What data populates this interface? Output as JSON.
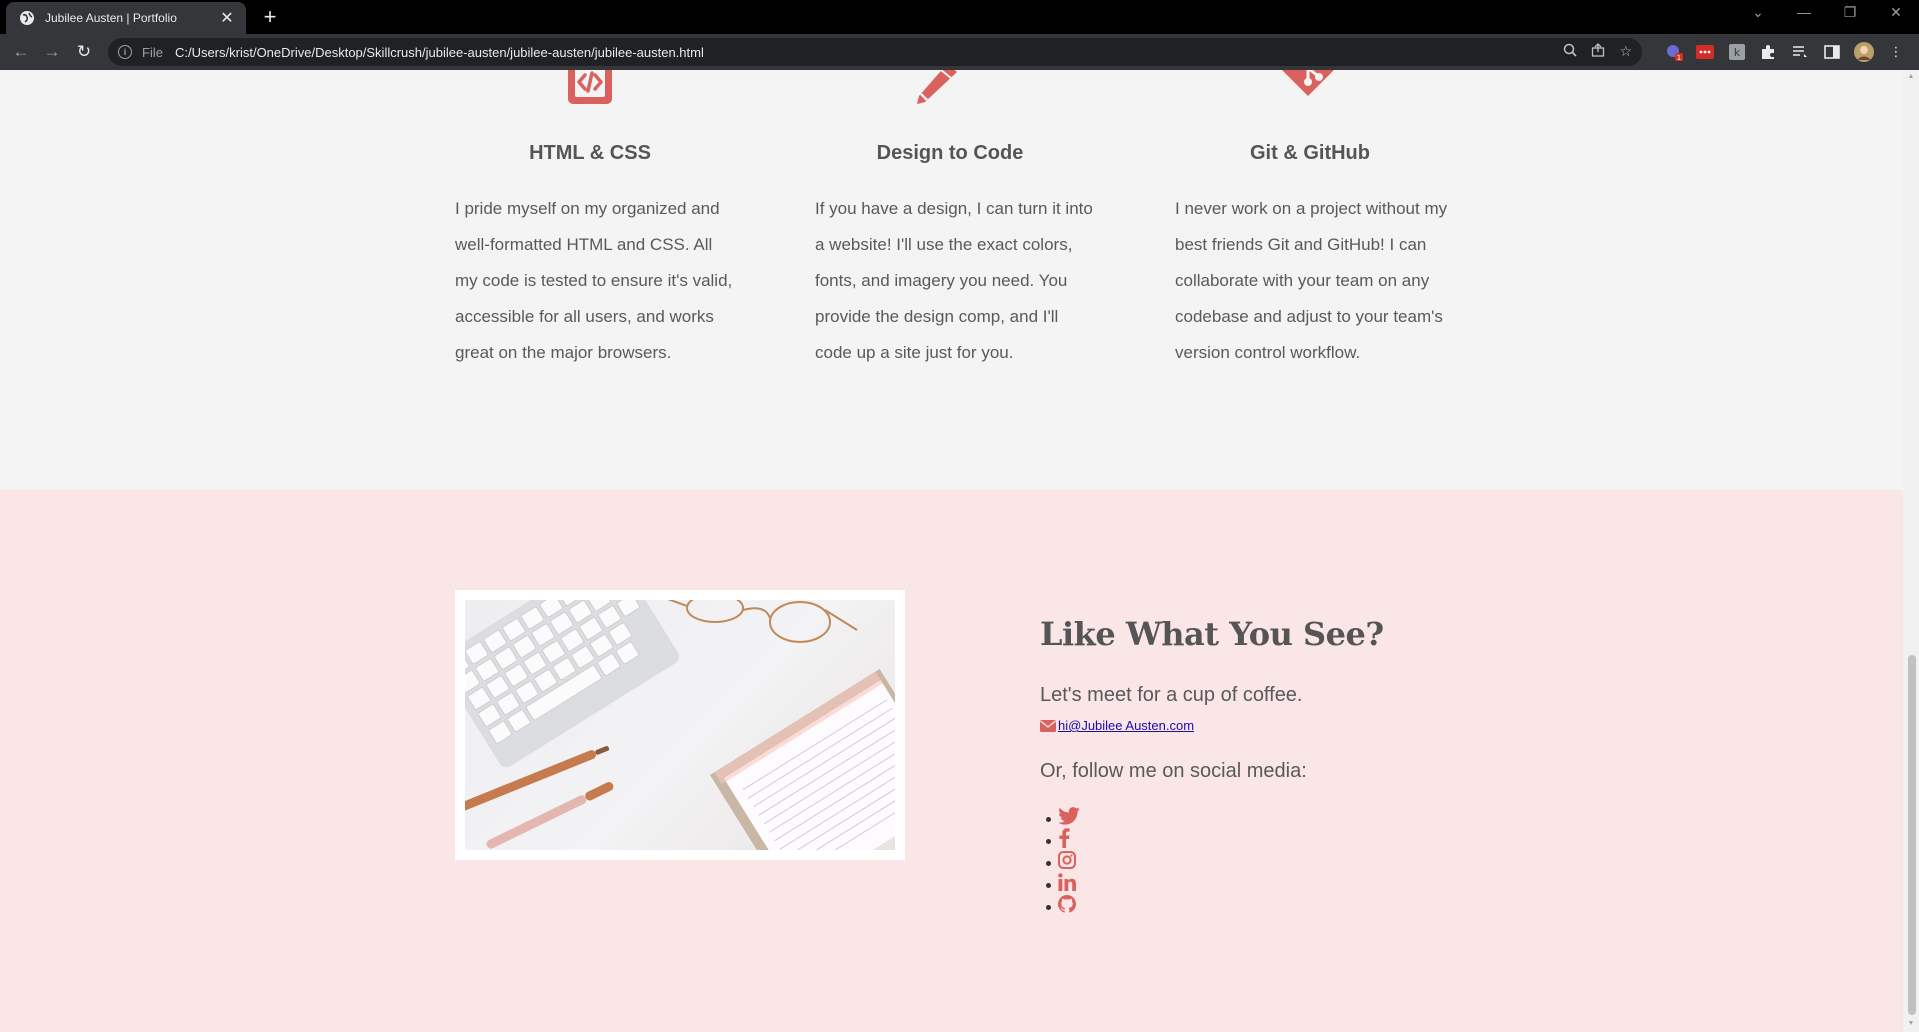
{
  "browser": {
    "tab_title": "Jubilee Austen | Portfolio",
    "scheme_label": "File",
    "url": "C:/Users/krist/OneDrive/Desktop/Skillcrush/jubilee-austen/jubilee-austen/jubilee-austen.html",
    "extension_badge": "1"
  },
  "skills": [
    {
      "icon": "code-file-icon",
      "title": "HTML & CSS",
      "description": "I pride myself on my organized and well-formatted HTML and CSS. All my code is tested to ensure it's valid, accessible for all users, and works great on the major browsers."
    },
    {
      "icon": "pencil-icon",
      "title": "Design to Code",
      "description": "If you have a design, I can turn it into a website! I'll use the exact colors, fonts, and imagery you need. You provide the design comp, and I'll code up a site just for you."
    },
    {
      "icon": "git-icon",
      "title": "Git & GitHub",
      "description": "I never work on a project without my best friends Git and GitHub! I can collaborate with your team on any codebase and adjust to your team's version control workflow."
    }
  ],
  "contact": {
    "heading": "Like What You See?",
    "coffee_text": "Let's meet for a cup of coffee.",
    "email": "hi@Jubilee Austen.com",
    "follow_text": "Or, follow me on social media:",
    "social": [
      "twitter-icon",
      "facebook-icon",
      "instagram-icon",
      "linkedin-icon",
      "github-icon"
    ]
  },
  "colors": {
    "accent": "#d9625e",
    "skills_bg": "#f4f4f4",
    "contact_bg": "#fae6e6",
    "text": "#595959"
  }
}
